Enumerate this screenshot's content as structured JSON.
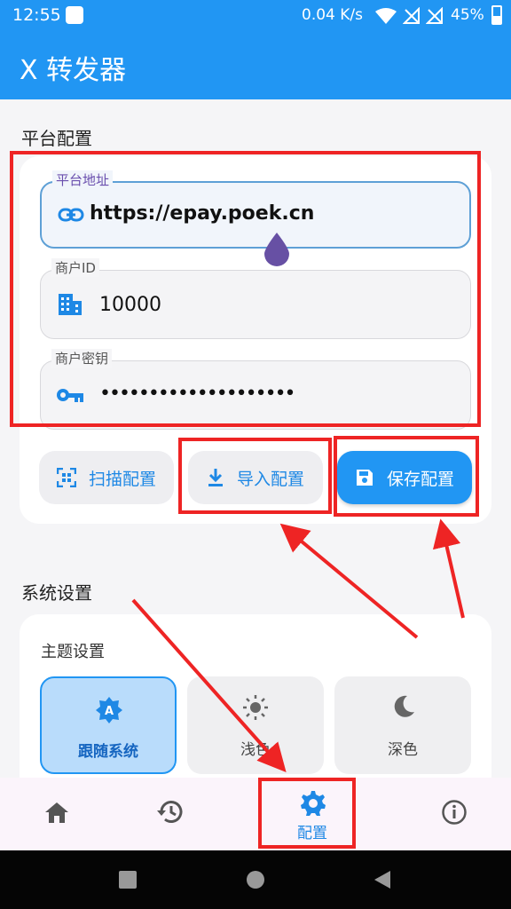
{
  "status_bar": {
    "time": "12:55",
    "speed": "0.04 K/s",
    "battery": "45%"
  },
  "app_bar": {
    "close_icon": "close-icon",
    "title": "X 转发器"
  },
  "platform_section": {
    "title": "平台配置",
    "fields": [
      {
        "label": "平台地址",
        "value": "https://epay.poek.cn",
        "icon": "link-icon"
      },
      {
        "label": "商户ID",
        "value": "10000",
        "icon": "building-icon"
      },
      {
        "label": "商户密钥",
        "value": "••••••••••••••••••••",
        "icon": "key-icon"
      }
    ],
    "buttons": {
      "scan": "扫描配置",
      "import": "导入配置",
      "save": "保存配置"
    }
  },
  "system_section": {
    "title": "系统设置",
    "theme_title": "主题设置",
    "theme_options": [
      {
        "label": "跟随系统",
        "icon": "auto-brightness-icon",
        "selected": true
      },
      {
        "label": "浅色",
        "icon": "sun-icon",
        "selected": false
      },
      {
        "label": "深色",
        "icon": "moon-icon",
        "selected": false
      }
    ]
  },
  "bottom_nav": {
    "items": [
      {
        "icon": "home-icon",
        "label": ""
      },
      {
        "icon": "history-icon",
        "label": ""
      },
      {
        "icon": "gear-icon",
        "label": "配置",
        "active": true
      },
      {
        "icon": "info-icon",
        "label": ""
      }
    ]
  },
  "colors": {
    "primary": "#2196f3",
    "annotation_red": "#ee2424",
    "cursor_purple": "#6750a4"
  }
}
